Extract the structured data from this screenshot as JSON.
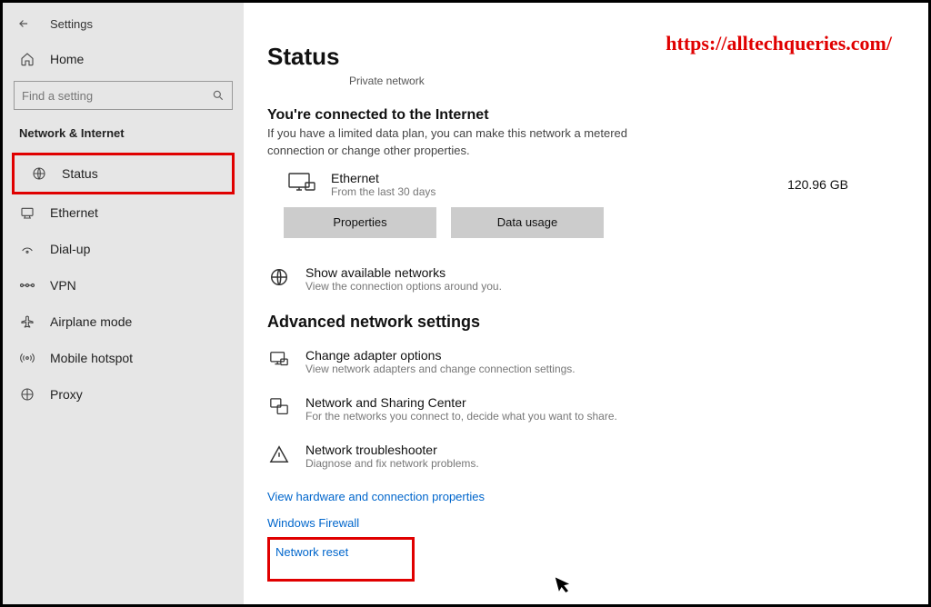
{
  "overlay_url": "https://alltechqueries.com/",
  "window_title": "Settings",
  "home_label": "Home",
  "search": {
    "placeholder": "Find a setting"
  },
  "nav_group_title": "Network & Internet",
  "sidebar": {
    "items": [
      {
        "label": "Status"
      },
      {
        "label": "Ethernet"
      },
      {
        "label": "Dial-up"
      },
      {
        "label": "VPN"
      },
      {
        "label": "Airplane mode"
      },
      {
        "label": "Mobile hotspot"
      },
      {
        "label": "Proxy"
      }
    ]
  },
  "main": {
    "title": "Status",
    "network_type": "Private network",
    "connected_heading": "You're connected to the Internet",
    "connected_body": "If you have a limited data plan, you can make this network a metered connection or change other properties.",
    "connection": {
      "name": "Ethernet",
      "period": "From the last 30 days",
      "data_used": "120.96 GB"
    },
    "buttons": {
      "properties": "Properties",
      "data_usage": "Data usage"
    },
    "available": {
      "title": "Show available networks",
      "desc": "View the connection options around you."
    },
    "advanced_title": "Advanced network settings",
    "adapter": {
      "title": "Change adapter options",
      "desc": "View network adapters and change connection settings."
    },
    "sharing": {
      "title": "Network and Sharing Center",
      "desc": "For the networks you connect to, decide what you want to share."
    },
    "troubleshoot": {
      "title": "Network troubleshooter",
      "desc": "Diagnose and fix network problems."
    },
    "links": {
      "hw": "View hardware and connection properties",
      "firewall": "Windows Firewall",
      "reset": "Network reset"
    }
  }
}
